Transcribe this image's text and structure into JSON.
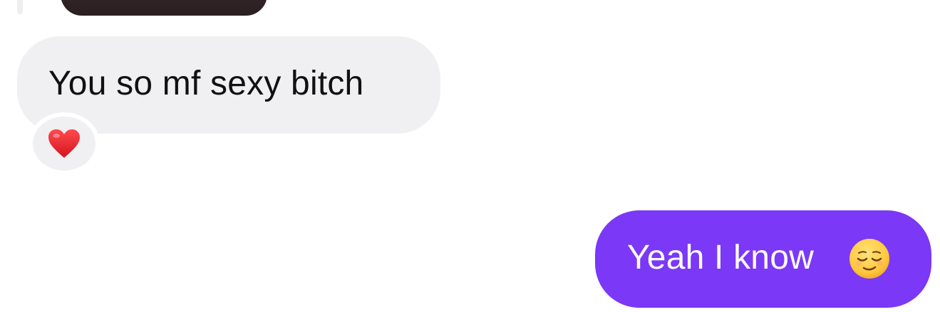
{
  "conversation": {
    "received_message": {
      "text": "You so mf sexy bitch",
      "reaction_icon": "red-heart-icon",
      "bubble_color": "#f0f0f2",
      "text_color": "#111111"
    },
    "sent_message": {
      "text": "Yeah I know",
      "emoji_icon": "relieved-face-icon",
      "bubble_color": "#7b38f7",
      "text_color": "#ffffff"
    }
  },
  "colors": {
    "background": "#ffffff",
    "heart": "#e8222d",
    "emoji_face": "#ffc83d"
  }
}
